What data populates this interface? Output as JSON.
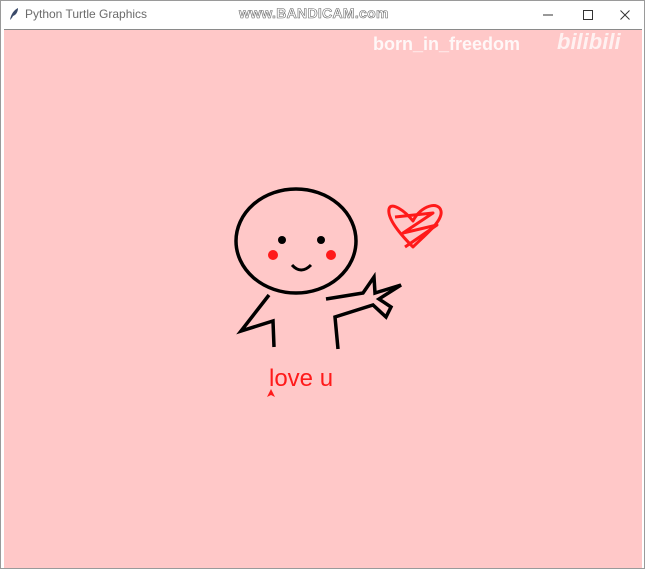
{
  "window": {
    "title": "Python Turtle Graphics",
    "minimize_icon": "minimize-icon",
    "maximize_icon": "maximize-icon",
    "close_icon": "close-icon"
  },
  "watermarks": {
    "recorder": "www.BANDICAM.com",
    "author": "born_in_freedom",
    "site_logo": "bilibili"
  },
  "canvas": {
    "background": "#ffc8c8",
    "text": "love u",
    "text_color": "#ff1a1a",
    "ink_color": "#000000",
    "blush_color": "#ff1a1a",
    "heart_color": "#ff1a1a"
  }
}
